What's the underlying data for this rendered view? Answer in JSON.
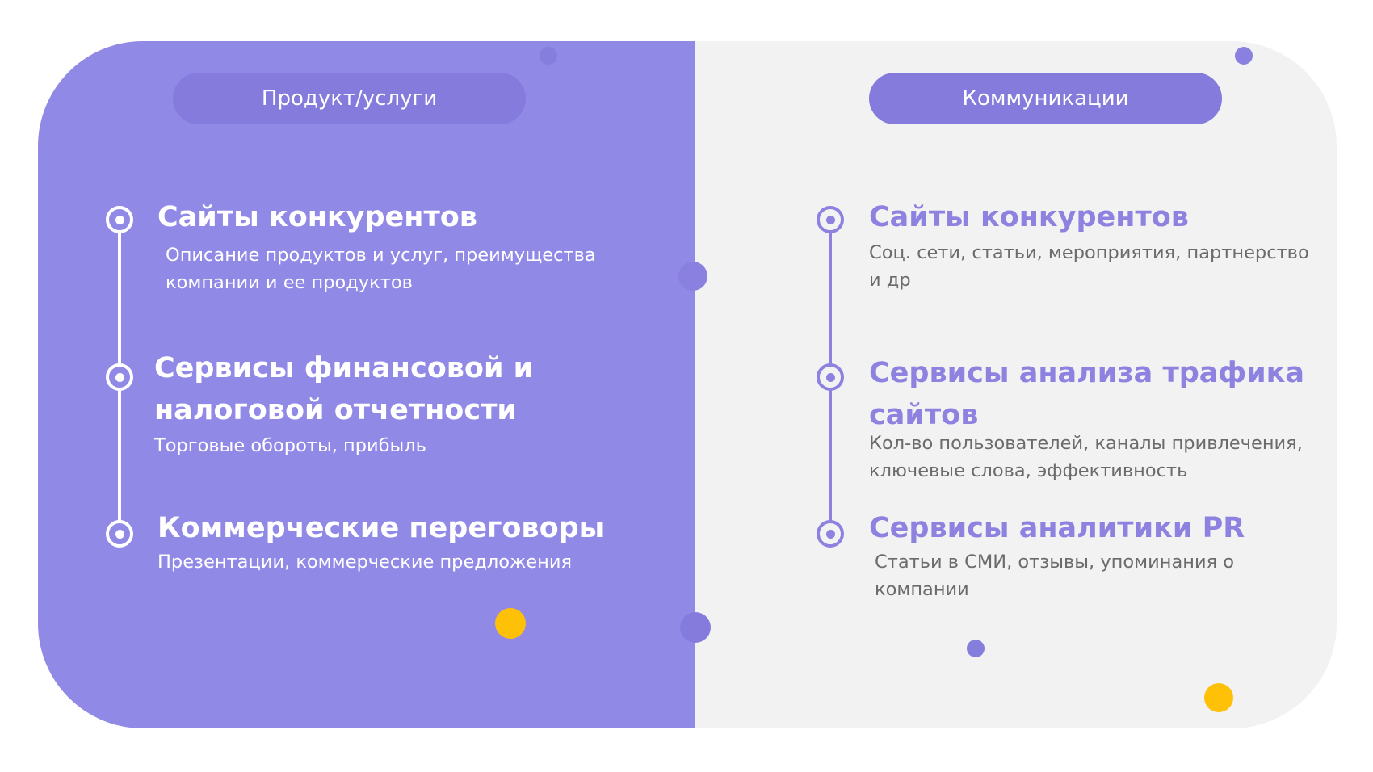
{
  "colors": {
    "left_bg": "#9189e6",
    "right_bg": "#f2f2f2",
    "pill": "#857bdd",
    "accent": "#8d82e0",
    "yellow": "#ffc107"
  },
  "left": {
    "header": "Продукт/услуги",
    "items": [
      {
        "title": "Сайты конкурентов",
        "desc": "Описание продуктов и услуг, преимущества компании и ее продуктов"
      },
      {
        "title": "Сервисы финансовой и налоговой отчетности",
        "desc": "Торговые обороты, прибыль"
      },
      {
        "title": "Коммерческие переговоры",
        "desc": "Презентации, коммерческие предложения"
      }
    ]
  },
  "right": {
    "header": "Коммуникации",
    "items": [
      {
        "title": "Сайты конкурентов",
        "desc": "Соц. сети, статьи, мероприятия, партнерство и др"
      },
      {
        "title": "Сервисы анализа трафика сайтов",
        "desc": "Кол-во пользователей, каналы привлечения, ключевые слова, эффективность"
      },
      {
        "title": "Сервисы аналитики PR",
        "desc": "Статьи в СМИ, отзывы, упоминания о компании"
      }
    ]
  }
}
